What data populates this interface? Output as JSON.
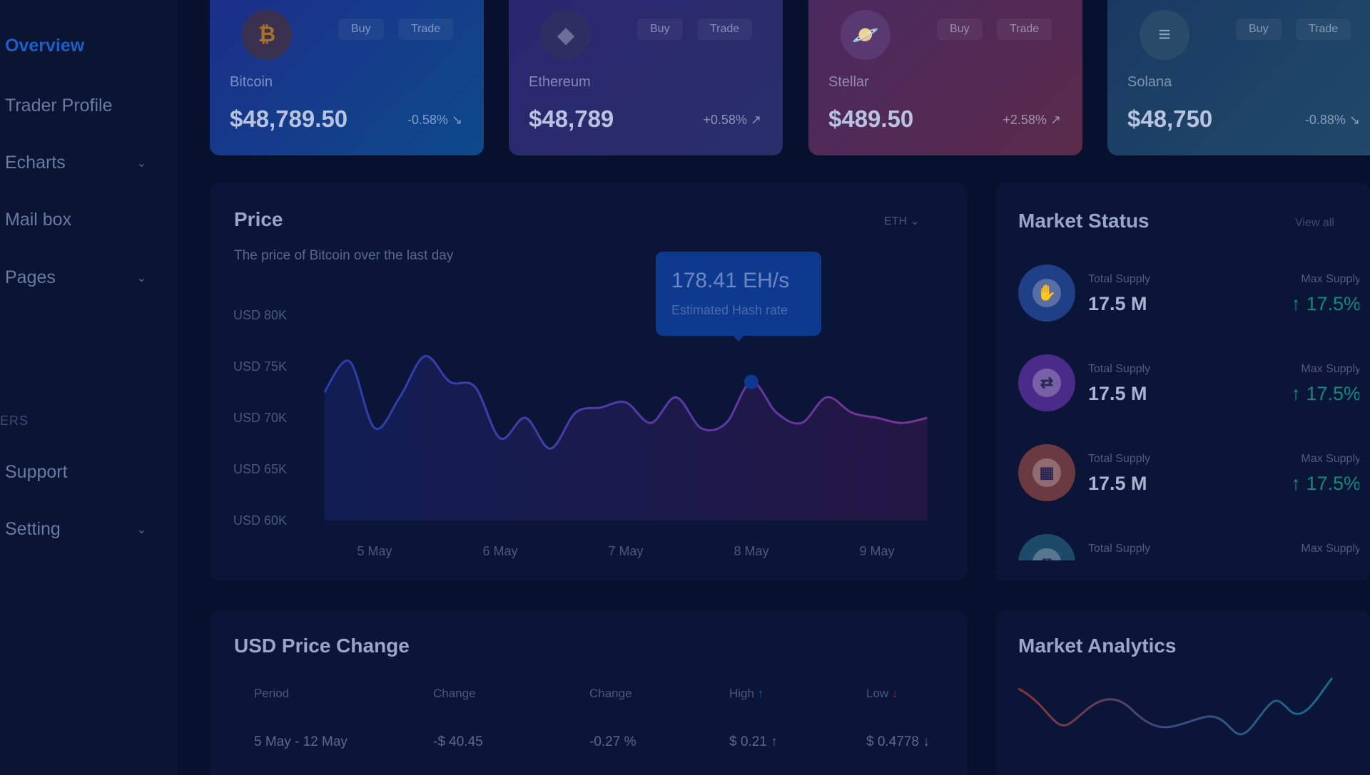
{
  "sidebar": {
    "items": [
      {
        "label": "Overview",
        "active": true
      },
      {
        "label": "Trader Profile"
      },
      {
        "label": "Echarts",
        "chevron": "chevron-down-icon"
      },
      {
        "label": "Mail box"
      },
      {
        "label": "Pages",
        "chevron": "chevron-down-icon"
      },
      {
        "label": "Support"
      },
      {
        "label": "Setting",
        "chevron": "chevron-down-icon"
      }
    ],
    "section_label": "ERS"
  },
  "coins": [
    {
      "name": "Bitcoin",
      "price": "$48,789.50",
      "change": "-0.58% ↘",
      "buy": "Buy",
      "trade": "Trade",
      "icon": "bitcoin-icon",
      "glyph": "₿"
    },
    {
      "name": "Ethereum",
      "price": "$48,789",
      "change": "+0.58% ↗",
      "buy": "Buy",
      "trade": "Trade",
      "icon": "ethereum-icon",
      "glyph": "◆"
    },
    {
      "name": "Stellar",
      "price": "$489.50",
      "change": "+2.58% ↗",
      "buy": "Buy",
      "trade": "Trade",
      "icon": "planet-icon",
      "glyph": "🪐"
    },
    {
      "name": "Solana",
      "price": "$48,750",
      "change": "-0.88% ↘",
      "buy": "Buy",
      "trade": "Trade",
      "icon": "solana-icon",
      "glyph": "≡"
    }
  ],
  "price_panel": {
    "title": "Price",
    "subtitle": "The price of Bitcoin over the last day",
    "selector": "ETH",
    "tooltip_value": "178.41 EH/s",
    "tooltip_label": "Estimated Hash rate"
  },
  "chart_data": {
    "type": "area",
    "y_ticks": [
      "USD 80K",
      "USD 75K",
      "USD 70K",
      "USD 65K",
      "USD 60K"
    ],
    "x_ticks": [
      "5 May",
      "6 May",
      "7 May",
      "8 May",
      "9 May"
    ],
    "ylim": [
      60000,
      80000
    ],
    "series": [
      {
        "x": [
          4.6,
          4.8,
          5.0,
          5.2,
          5.4,
          5.6,
          5.8,
          6.0,
          6.2,
          6.4,
          6.6,
          6.8,
          7.0,
          7.2,
          7.4,
          7.6,
          7.8,
          8.0,
          8.2,
          8.4,
          8.6,
          8.8,
          9.0,
          9.2,
          9.4
        ],
        "y": [
          72500,
          75500,
          69000,
          72000,
          76000,
          73500,
          73000,
          68000,
          70000,
          67000,
          70500,
          71000,
          71500,
          69500,
          72000,
          69000,
          69500,
          73500,
          70500,
          69500,
          72000,
          70500,
          70000,
          69500,
          70000
        ]
      }
    ],
    "highlight": {
      "x": "8 May",
      "label": "178.41 EH/s"
    }
  },
  "market_status": {
    "title": "Market Status",
    "view_all": "View all",
    "rows": [
      {
        "label": "Total Supply",
        "value": "17.5 M",
        "max_label": "Max Supply",
        "max_value": "17.5%",
        "color": "#4a7fe6",
        "icon": "hand-coin-icon"
      },
      {
        "label": "Total Supply",
        "value": "17.5 M",
        "max_label": "Max Supply",
        "max_value": "17.5%",
        "color": "#a052e8",
        "icon": "exchange-icon"
      },
      {
        "label": "Total Supply",
        "value": "17.5 M",
        "max_label": "Max Supply",
        "max_value": "17.5%",
        "color": "#f07a5c",
        "icon": "grid-icon"
      },
      {
        "label": "Total Supply",
        "value": "",
        "max_label": "Max Supply",
        "max_value": "",
        "color": "#4fb8e6",
        "icon": "coin-icon"
      }
    ]
  },
  "price_change": {
    "title": "USD Price Change",
    "headers": [
      "Period",
      "Change",
      "Change",
      "High",
      "Low"
    ],
    "rows": [
      [
        "5 May - 12 May",
        "-$ 40.45",
        "-0.27 %",
        "$ 0.21 ↑",
        "$ 0.4778 ↓"
      ]
    ]
  },
  "analytics": {
    "title": "Market Analytics"
  },
  "colors": {
    "accent": "#1e5ec8",
    "positive": "#0f8b7c",
    "negative": "#c0392b"
  }
}
